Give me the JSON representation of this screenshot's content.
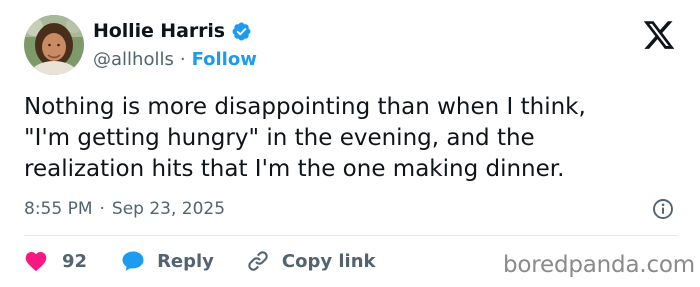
{
  "author": {
    "display_name": "Hollie Harris",
    "handle": "@allholls",
    "separator": "·",
    "follow_label": "Follow",
    "verified": true
  },
  "tweet": {
    "lines": [
      "Nothing is more disappointing than when I think,",
      "\"I'm getting hungry\" in the evening, and the",
      "realization hits that I'm the one making dinner."
    ]
  },
  "meta": {
    "time": "8:55 PM",
    "separator": "·",
    "date": "Sep 23, 2025"
  },
  "actions": {
    "like_count": "92",
    "reply_label": "Reply",
    "copy_link_label": "Copy link"
  },
  "watermark": {
    "text": "boredpanda.com"
  },
  "colors": {
    "accent": "#1d9bf0",
    "like": "#f91880",
    "text": "#0f1419",
    "secondary": "#536471"
  },
  "icons": {
    "logo": "x-logo-icon",
    "verified": "verified-badge-icon",
    "info": "info-icon",
    "like": "heart-icon",
    "reply": "speech-bubble-icon",
    "copy_link": "link-icon"
  }
}
